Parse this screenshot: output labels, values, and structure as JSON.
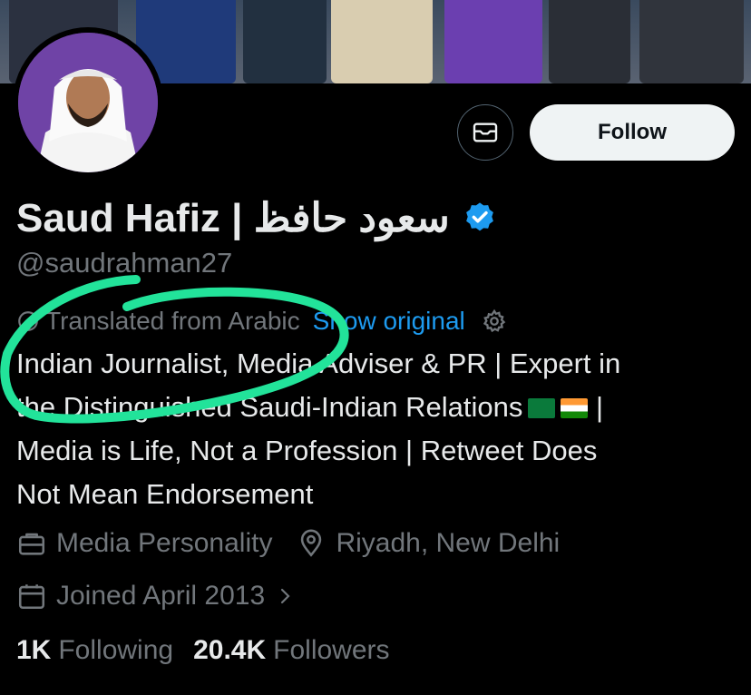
{
  "profile": {
    "name": "Saud Hafiz | سعود حافظ",
    "handle": "@saudrahman27",
    "follow_label": "Follow"
  },
  "translation": {
    "note": "Translated from Arabic",
    "show_original": "Show original"
  },
  "bio": {
    "line1": "Indian Journalist, Media Adviser & PR | Expert in",
    "line2": "the Distinguished Saudi-Indian Relations",
    "line2_tail": " |",
    "line3": "Media is Life, Not a Profession | Retweet Does",
    "line4": "Not Mean Endorsement"
  },
  "meta": {
    "category": "Media Personality",
    "location": "Riyadh, New Delhi",
    "joined": "Joined April 2013"
  },
  "stats": {
    "following_count": "1K",
    "following_label": "Following",
    "followers_count": "20.4K",
    "followers_label": "Followers"
  },
  "colors": {
    "background": "#000000",
    "accent": "#1d9bf0",
    "muted": "#71767b",
    "annotation": "#22e39a"
  },
  "icons": [
    "envelope-icon",
    "verified-badge-icon",
    "globe-icon",
    "gear-icon",
    "briefcase-icon",
    "location-pin-icon",
    "calendar-icon",
    "chevron-right-icon"
  ]
}
